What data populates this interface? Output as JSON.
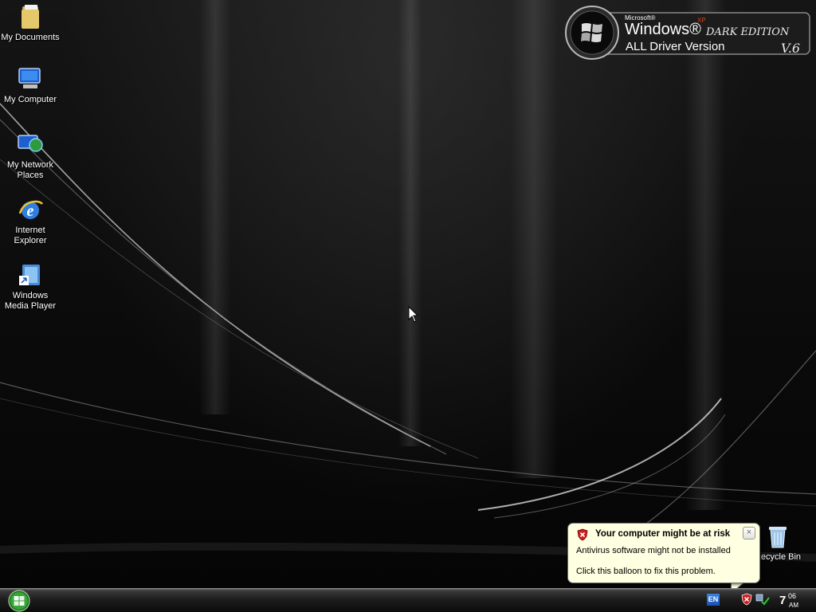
{
  "desktop": {
    "icons": [
      {
        "label": "My Documents",
        "icon": "folder-documents-icon"
      },
      {
        "label": "My Computer",
        "icon": "computer-icon"
      },
      {
        "label": "My Network Places",
        "icon": "network-places-icon"
      },
      {
        "label": "Internet Explorer",
        "icon": "internet-explorer-icon"
      },
      {
        "label": "Windows Media Player",
        "icon": "media-player-icon"
      },
      {
        "label": "Recycle Bin",
        "icon": "recycle-bin-icon"
      }
    ]
  },
  "logo": {
    "microsoft": "Microsoft®",
    "windows": "Windows®",
    "xp": "XP",
    "edition": "DARK EDITION",
    "driver": "ALL Driver Version",
    "version": "V.6"
  },
  "balloon": {
    "title": "Your computer might be at risk",
    "line1": "Antivirus software might not be installed",
    "line2": "Click this balloon to fix this problem.",
    "close": "×"
  },
  "taskbar": {
    "language": "EN",
    "clock": {
      "hour": "7",
      "minutes": "06",
      "ampm": "AM"
    }
  },
  "colors": {
    "balloon_bg": "#ffffe1",
    "shield_red": "#cc1f1f",
    "start_green": "#3aa537"
  }
}
